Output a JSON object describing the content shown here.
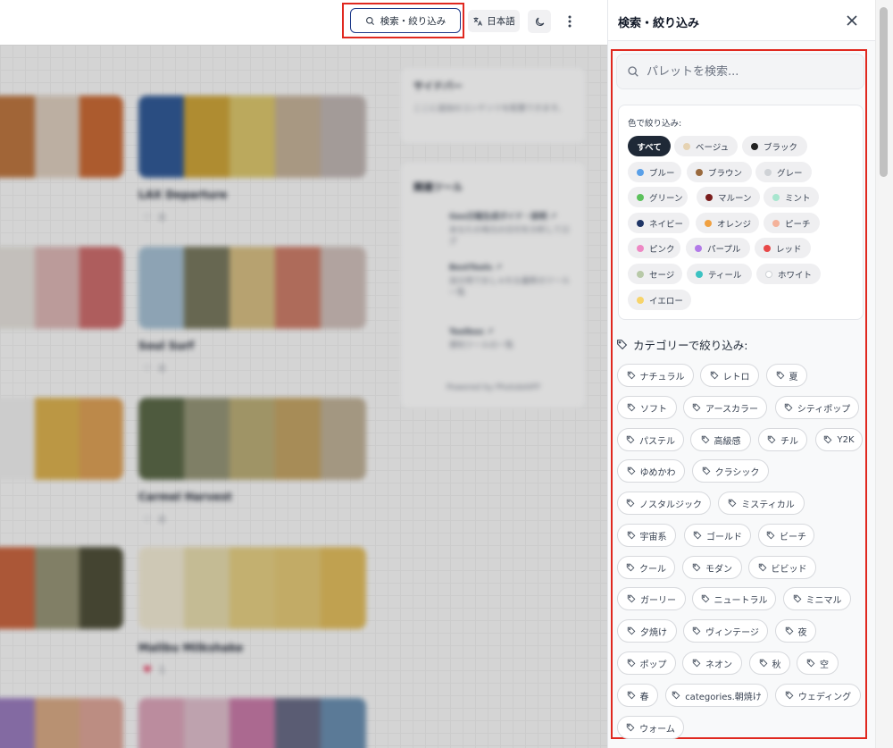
{
  "header": {
    "search_button_label": "検索・絞り込み",
    "language_label": "日本語",
    "dark_mode_icon": "moon-icon",
    "more_icon": "more-vertical-icon"
  },
  "background": {
    "palettes": [
      {
        "name": "",
        "colors": [
          "#b5682e",
          "#d8c7b6",
          "#c35b22"
        ]
      },
      {
        "name": "LAX Departure",
        "colors": [
          "#1d4a8c",
          "#c79a26",
          "#d6bf5e",
          "#bea98e",
          "#b8adaa"
        ]
      },
      {
        "name": "",
        "colors": [
          "#e0dcd6",
          "#d6aeac",
          "#c65e5e"
        ]
      },
      {
        "name": "Soul Surf",
        "colors": [
          "#9bb8cd",
          "#6b6b4f",
          "#d1b777",
          "#c6705a",
          "#c9b8b2"
        ]
      },
      {
        "name": "",
        "colors": [
          "#ececec",
          "#d6a83e",
          "#d89646"
        ]
      },
      {
        "name": "Carmel Harvest",
        "colors": [
          "#4b5a36",
          "#8a8a6a",
          "#b3a46a",
          "#bd9a56",
          "#b8a88c"
        ]
      },
      {
        "name": "",
        "colors": [
          "#c2562d",
          "#8c8a6a",
          "#3e3e26"
        ]
      },
      {
        "name": "Malibu Milkshake",
        "colors": [
          "#efe7cf",
          "#e2d6a4",
          "#e0c877",
          "#dfc26a",
          "#ddb54e"
        ]
      },
      {
        "name": "",
        "colors": [
          "#8f6fb6",
          "#d3a079",
          "#d89b8d"
        ]
      },
      {
        "name": "",
        "colors": [
          "#d69ab1",
          "#dab7c6",
          "#c26e9f",
          "#5a5d7a",
          "#5b83a8"
        ]
      }
    ],
    "like_counts": [
      "0",
      "0",
      "0",
      "1"
    ],
    "sidebar_title": "サイドバー",
    "sidebar_text": "ここに追加のコンテンツを配置できます。",
    "related_title": "関連ツール",
    "related": [
      {
        "title": "Geo日報生成ガイド・説明 ↗",
        "desc": "あなたの地元の日付を分析してログ"
      },
      {
        "title": "BestTools ↗",
        "desc": "自分用でおしゃれな最新のツール一覧"
      },
      {
        "title": "Toolbox ↗",
        "desc": "便利ツールの一覧"
      }
    ],
    "powered_by": "Powered by PhotobAIFF"
  },
  "panel": {
    "title": "検索・絞り込み",
    "close_icon": "close-icon",
    "search_placeholder": "パレットを検索...",
    "color_label": "色で絞り込み:",
    "colors": [
      {
        "label": "すべて",
        "dot": null,
        "active": true
      },
      {
        "label": "ベージュ",
        "dot": "#e6d3b3"
      },
      {
        "label": "ブラック",
        "dot": "#222222"
      },
      {
        "label": "ブルー",
        "dot": "#5aa0e8"
      },
      {
        "label": "ブラウン",
        "dot": "#9a6a3e"
      },
      {
        "label": "グレー",
        "dot": "#cfd2d6"
      },
      {
        "label": "グリーン",
        "dot": "#5cc15c"
      },
      {
        "label": "マルーン",
        "dot": "#7a1d1d"
      },
      {
        "label": "ミント",
        "dot": "#a8e6cf"
      },
      {
        "label": "ネイビー",
        "dot": "#1f3566"
      },
      {
        "label": "オレンジ",
        "dot": "#f0a040"
      },
      {
        "label": "ピーチ",
        "dot": "#f4b29a"
      },
      {
        "label": "ピンク",
        "dot": "#ee88c4"
      },
      {
        "label": "パープル",
        "dot": "#b27ae8"
      },
      {
        "label": "レッド",
        "dot": "#e84848"
      },
      {
        "label": "セージ",
        "dot": "#b8c9a8"
      },
      {
        "label": "ティール",
        "dot": "#3cc2c2"
      },
      {
        "label": "ホワイト",
        "dot": "#ffffff"
      },
      {
        "label": "イエロー",
        "dot": "#f7d46a"
      }
    ],
    "category_label": "カテゴリーで絞り込み:",
    "categories": [
      "ナチュラル",
      "レトロ",
      "夏",
      "ソフト",
      "アースカラー",
      "シティポップ",
      "パステル",
      "高級感",
      "チル",
      "Y2K",
      "ゆめかわ",
      "クラシック",
      "ノスタルジック",
      "ミスティカル",
      "宇宙系",
      "ゴールド",
      "ビーチ",
      "クール",
      "モダン",
      "ビビッド",
      "ガーリー",
      "ニュートラル",
      "ミニマル",
      "夕焼け",
      "ヴィンテージ",
      "夜",
      "ポップ",
      "ネオン",
      "秋",
      "空",
      "春",
      "categories.朝焼け",
      "ウェディング",
      "ウォーム"
    ]
  },
  "colors": {
    "highlight": "#e0281f",
    "active_chip": "#1f2937",
    "search_border": "#1e3a8a"
  }
}
